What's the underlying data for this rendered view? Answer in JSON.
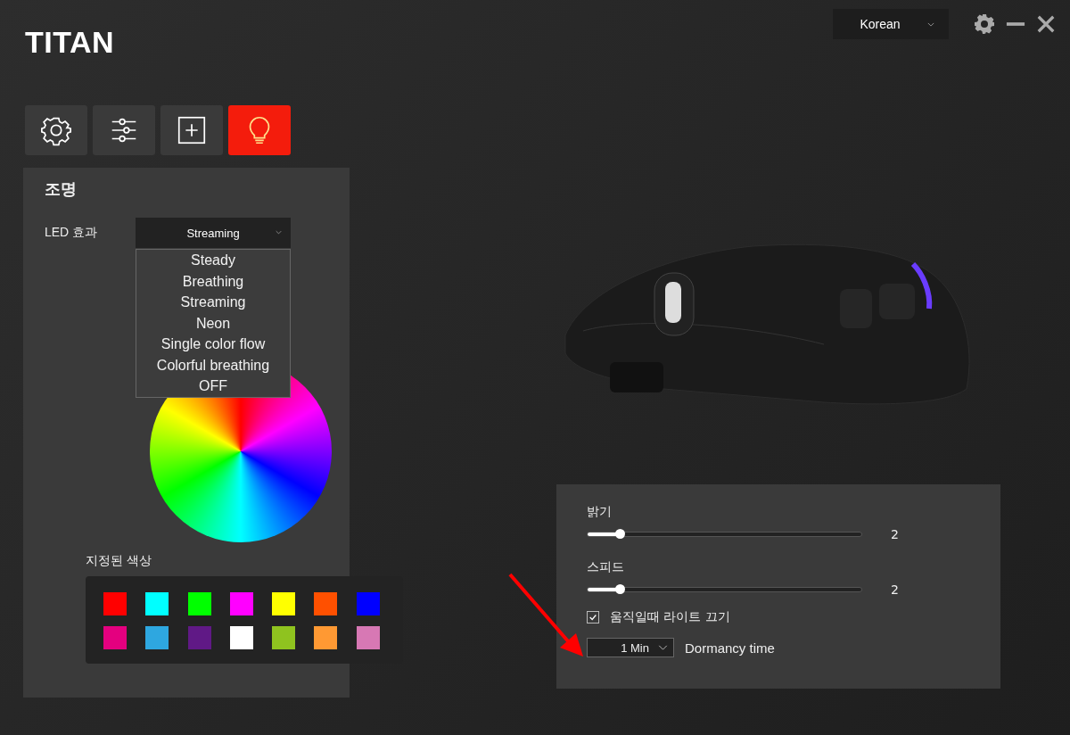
{
  "app": {
    "logo": "TITAN",
    "language": "Korean"
  },
  "tabs": [
    {
      "kind": "gear",
      "selected": false
    },
    {
      "kind": "sliders",
      "selected": false
    },
    {
      "kind": "plus",
      "selected": false
    },
    {
      "kind": "bulb",
      "selected": true
    }
  ],
  "lighting": {
    "title": "조명",
    "led_label": "LED 효과",
    "led_value": "Streaming",
    "led_options": [
      "Steady",
      "Breathing",
      "Streaming",
      "Neon",
      "Single color flow",
      "Colorful breathing",
      "OFF"
    ],
    "preset_label": "지정된 색상",
    "presets": [
      {
        "color": "#ff0000"
      },
      {
        "color": "#00ffff"
      },
      {
        "color": "#00ff00"
      },
      {
        "color": "#ff00ff"
      },
      {
        "color": "#ffff00"
      },
      {
        "color": "#ff5000"
      },
      {
        "color": "#0000ff"
      },
      {
        "color": "#e4007f"
      },
      {
        "color": "#2ea7e0"
      },
      {
        "color": "#601986"
      },
      {
        "color": "#ffffff"
      },
      {
        "color": "#8fc31f"
      },
      {
        "color": "#ff9933"
      },
      {
        "color": "#d778b4"
      }
    ]
  },
  "settings": {
    "sliders": [
      {
        "label": "밝기",
        "level": 0.12,
        "reading": "2"
      },
      {
        "label": "스피드",
        "level": 0.12,
        "reading": "2"
      }
    ],
    "light_off_on_move": {
      "label": "움직일때 라이트 끄기",
      "checked": true
    },
    "dormancy": {
      "value": "1 Min",
      "label": "Dormancy time"
    }
  }
}
